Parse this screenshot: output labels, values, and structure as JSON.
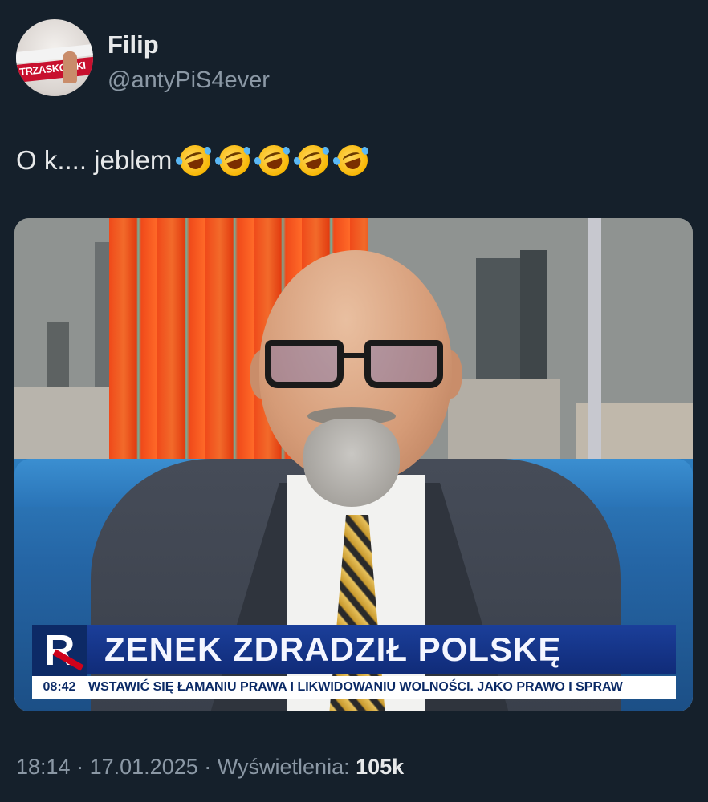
{
  "tweet": {
    "author_name": "Filip",
    "author_handle": "@antyPiS4ever",
    "avatar_text": "TRZASKO SKI",
    "text": "O k.... jeblem",
    "emoji_count": 5,
    "emoji_name": "rolling-on-floor-laughing-icon"
  },
  "media": {
    "headline": "ZENEK ZDRADZIŁ POLSKĘ",
    "time": "08:42",
    "crawl": "WSTAWIĆ SIĘ ŁAMANIU PRAWA I LIKWIDOWANIU WOLNOŚCI. JAKO PRAWO I SPRAW",
    "channel_logo": "R"
  },
  "footer": {
    "time": "18:14",
    "date": "17.01.2025",
    "views_label": "Wyświetlenia:",
    "views_value": "105k",
    "separator": "·"
  },
  "colors": {
    "background": "#15202b",
    "text_primary": "#e7e9ea",
    "text_secondary": "#8b98a5",
    "tv_headline_bg": "#1b3f9a"
  }
}
